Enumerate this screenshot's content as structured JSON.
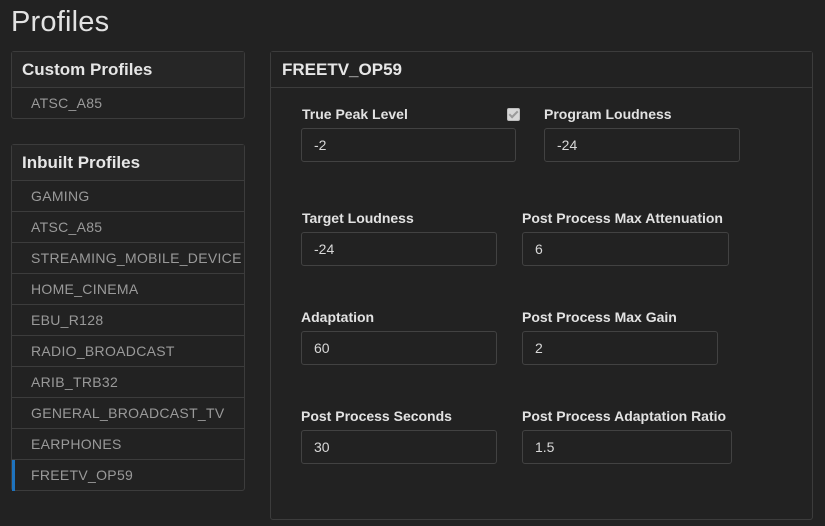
{
  "page": {
    "title": "Profiles"
  },
  "custom_profiles": {
    "header": "Custom Profiles",
    "items": [
      "ATSC_A85"
    ]
  },
  "inbuilt_profiles": {
    "header": "Inbuilt Profiles",
    "items": [
      "GAMING",
      "ATSC_A85",
      "STREAMING_MOBILE_DEVICE",
      "HOME_CINEMA",
      "EBU_R128",
      "RADIO_BROADCAST",
      "ARIB_TRB32",
      "GENERAL_BROADCAST_TV",
      "EARPHONES",
      "FREETV_OP59"
    ],
    "selected": "FREETV_OP59"
  },
  "detail": {
    "title": "FREETV_OP59",
    "true_peak_level": {
      "label": "True Peak Level",
      "value": "-2",
      "checked": true
    },
    "program_loudness": {
      "label": "Program Loudness",
      "value": "-24"
    },
    "target_loudness": {
      "label": "Target Loudness",
      "value": "-24"
    },
    "post_process_max_attenuation": {
      "label": "Post Process Max Attenuation",
      "value": "6"
    },
    "adaptation": {
      "label": "Adaptation",
      "value": "60"
    },
    "post_process_max_gain": {
      "label": "Post Process Max Gain",
      "value": "2"
    },
    "post_process_seconds": {
      "label": "Post Process Seconds",
      "value": "30"
    },
    "post_process_adaptation_ratio": {
      "label": "Post Process Adaptation Ratio",
      "value": "1.5"
    }
  },
  "colors": {
    "background": "#222222",
    "border": "#3c3c3c",
    "selected_accent": "#1e73be"
  }
}
